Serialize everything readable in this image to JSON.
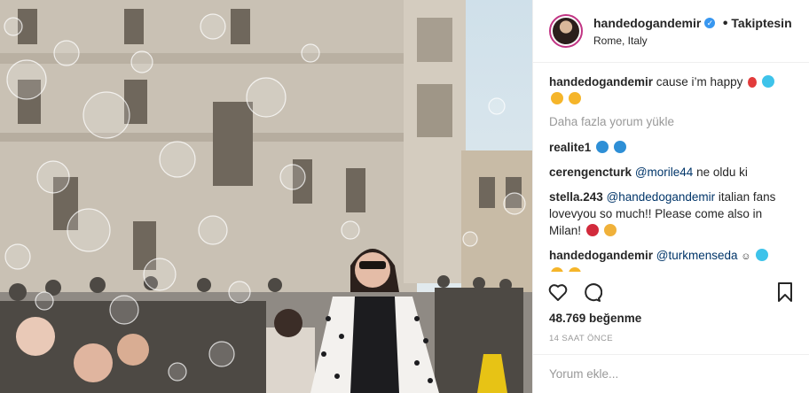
{
  "post": {
    "username": "handedogandemir",
    "follow_state": "Takiptesin",
    "separator": "•",
    "location": "Rome, Italy",
    "caption_user": "handedogandemir",
    "caption_text": "cause i’m happy"
  },
  "comments": {
    "load_more": "Daha fazla yorum yükle",
    "items": [
      {
        "user": "realite1",
        "mention": "",
        "text": ""
      },
      {
        "user": "cerengencturk",
        "mention": "@morile44",
        "text": "ne oldu ki"
      },
      {
        "user": "stella.243",
        "mention": "@handedogandemir",
        "text": "italian fans lovevyou so much!! Please come also in Milan!"
      },
      {
        "user": "handedogandemir",
        "mention": "@turkmenseda",
        "text": ""
      }
    ]
  },
  "actions": {
    "icons": [
      "heart-icon",
      "comment-icon",
      "save-icon"
    ]
  },
  "likes": "48.769 beğenme",
  "timestamp": "14 SAAT ÖNCE",
  "add_comment_placeholder": "Yorum ekle..."
}
